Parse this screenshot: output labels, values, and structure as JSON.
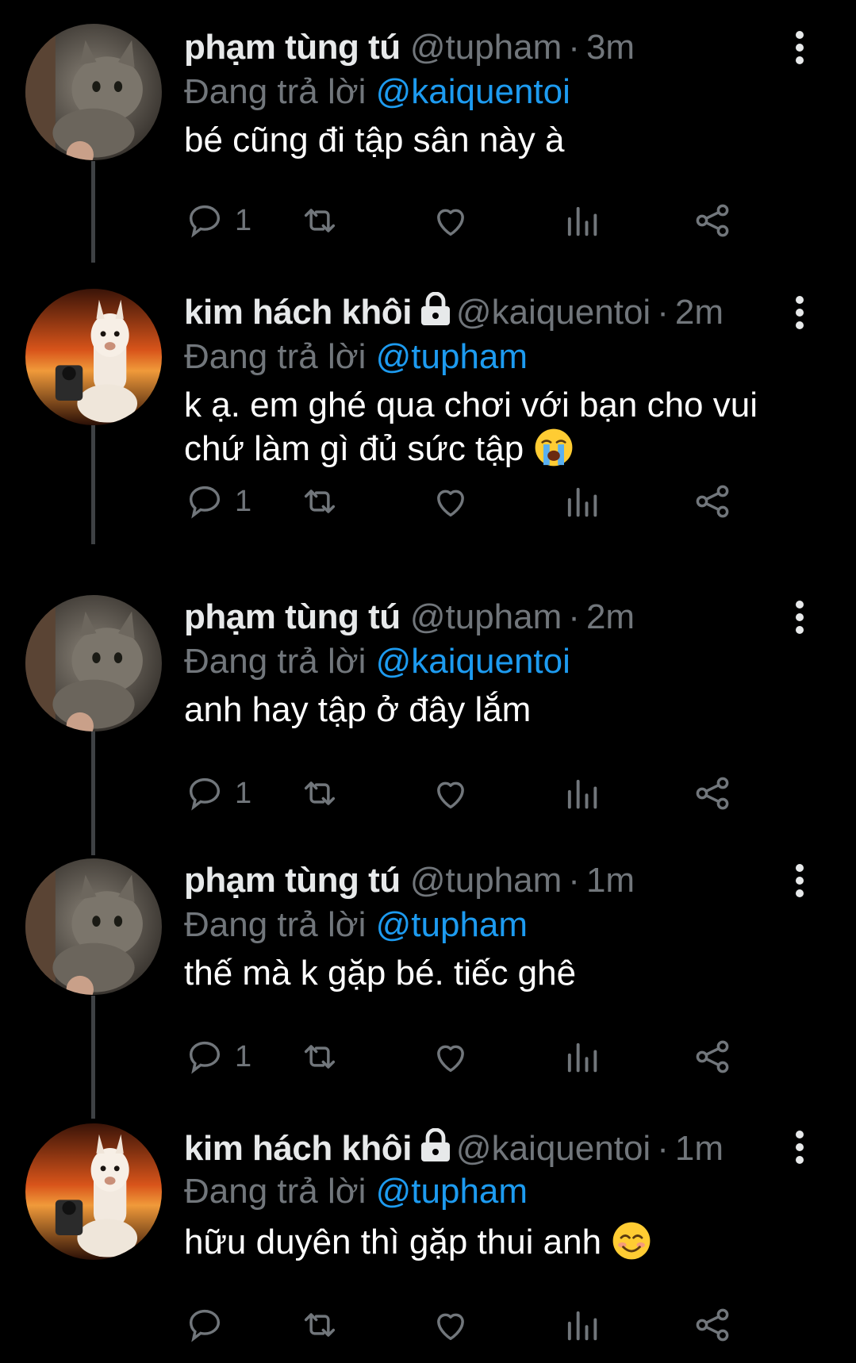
{
  "colors": {
    "background": "#000000",
    "text": "#e7e9ea",
    "muted": "#71767b",
    "mention": "#1d9bf0",
    "thread_line": "#3e4144"
  },
  "reply_prefix": "Đang trả lời",
  "tweets": [
    {
      "author": "phạm tùng tú",
      "handle": "@tupham",
      "separator": "·",
      "time": "3m",
      "protected": false,
      "reply_to": "@kaiquentoi",
      "text": "bé cũng đi tập sân này à",
      "emoji": "",
      "reply_count": "1",
      "avatar": "cat-avatar"
    },
    {
      "author": "kim hách khôi",
      "handle": "@kaiquentoi",
      "separator": "·",
      "time": "2m",
      "protected": true,
      "reply_to": "@tupham",
      "text": "k ạ. em ghé qua chơi với bạn cho vui\nchứ làm gì đủ sức tập",
      "emoji": "crying-face-emoji",
      "reply_count": "1",
      "avatar": "alpaca-avatar"
    },
    {
      "author": "phạm tùng tú",
      "handle": "@tupham",
      "separator": "·",
      "time": "2m",
      "protected": false,
      "reply_to": "@kaiquentoi",
      "text": "anh hay tập ở đây lắm",
      "emoji": "",
      "reply_count": "1",
      "avatar": "cat-avatar"
    },
    {
      "author": "phạm tùng tú",
      "handle": "@tupham",
      "separator": "·",
      "time": "1m",
      "protected": false,
      "reply_to": "@tupham",
      "text": "thế mà k gặp bé. tiếc ghê",
      "emoji": "",
      "reply_count": "1",
      "avatar": "cat-avatar"
    },
    {
      "author": "kim hách khôi",
      "handle": "@kaiquentoi",
      "separator": "·",
      "time": "1m",
      "protected": true,
      "reply_to": "@tupham",
      "text": "hữu duyên thì gặp thui anh",
      "emoji": "smiling-face-emoji",
      "reply_count": "",
      "avatar": "alpaca-avatar"
    }
  ]
}
